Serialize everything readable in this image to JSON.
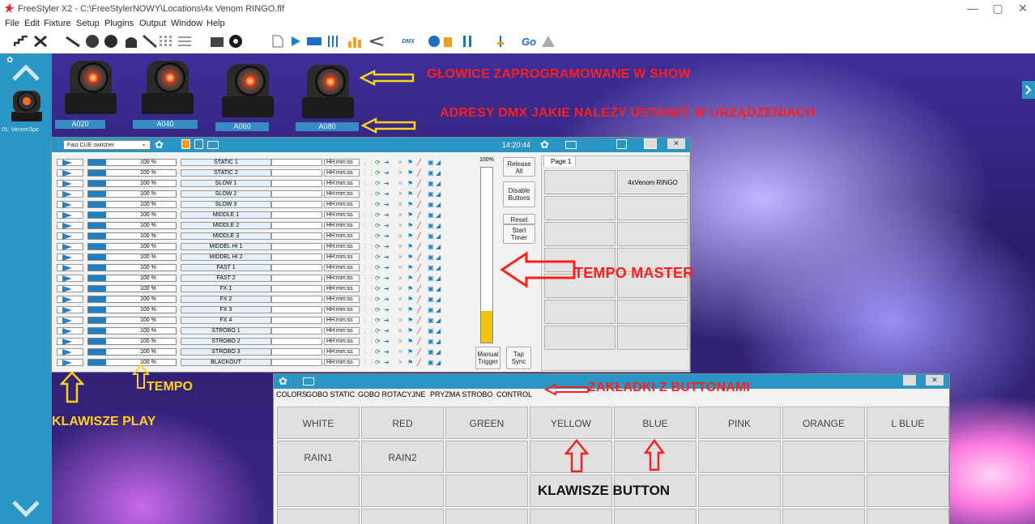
{
  "window": {
    "title": "FreeStyler X2  -  C:\\FreeStylerNOWY\\Locations\\4x Venom RINGO.flf",
    "minimize": "—",
    "maximize": "▢",
    "close": "✕"
  },
  "menu": [
    "File",
    "Edit",
    "Fixture",
    "Setup",
    "Plugins",
    "Output",
    "Window",
    "Help"
  ],
  "toolbar": {
    "dmx_label": "DMX",
    "go_label": "Go"
  },
  "sidebar": {
    "fixture_label": "01: VenomSpo"
  },
  "fixtures": {
    "addresses": [
      "A020",
      "A040",
      "A060",
      "A080"
    ]
  },
  "annotations": {
    "heads": "GŁOWICE ZAPROGRAMOWANE W SHOW",
    "dmx": "ADRESY DMX JAKIE NALEŻY USTAWIĆ W URZĄDZENIACH",
    "tempo_master": "TEMPO MASTER",
    "tempo": "TEMPO",
    "play_keys": "KLAWISZE PLAY",
    "tabs": "ZAKŁADKI Z BUTTONAMI",
    "button_keys": "KLAWISZE BUTTON"
  },
  "cue_panel": {
    "dropdown": "Fast CUE switcher",
    "clock": "14:20:44",
    "percent_label": "100%",
    "master_level": 0.18,
    "speed": "100 %",
    "time_placeholder": "HH:mm:ss",
    "cues": [
      "STATIC 1",
      "STATIC 2",
      "SLOW 1",
      "SLOW 2",
      "SLOW 3",
      "MIDDLE 1",
      "MIDDLE 2",
      "MIDDLE 3",
      "MIDDEL HI 1",
      "MIDDEL HI 2",
      "FAST 1",
      "FAST 2",
      "FX 1",
      "FX 2",
      "FX 3",
      "FX 4",
      "STROBO 1",
      "STROBO 2",
      "STROBO 3",
      "BLACKOUT"
    ],
    "buttons": {
      "release": "Release All",
      "disable": "Disable Buttons",
      "reset": "Reset",
      "start": "Start Timer",
      "manual": "Manual Trigger",
      "tap": "Tap Sync"
    },
    "page_tab": "Page 1",
    "show_button": "4xVenom RINGO"
  },
  "button_panel": {
    "tabs": [
      "COLORS",
      "GOBO STATIC",
      "GOBO ROTACYJNE",
      "PRYZMA STROBO",
      "CONTROL"
    ],
    "row1": [
      "WHITE",
      "RED",
      "GREEN",
      "YELLOW",
      "BLUE",
      "PINK",
      "ORANGE",
      "L BLUE"
    ],
    "row2": [
      "RAIN1",
      "RAIN2"
    ]
  },
  "colors": {
    "accent": "#2b95c4",
    "annotation_red": "#ff1f1f",
    "annotation_yellow": "#ffd21a"
  }
}
